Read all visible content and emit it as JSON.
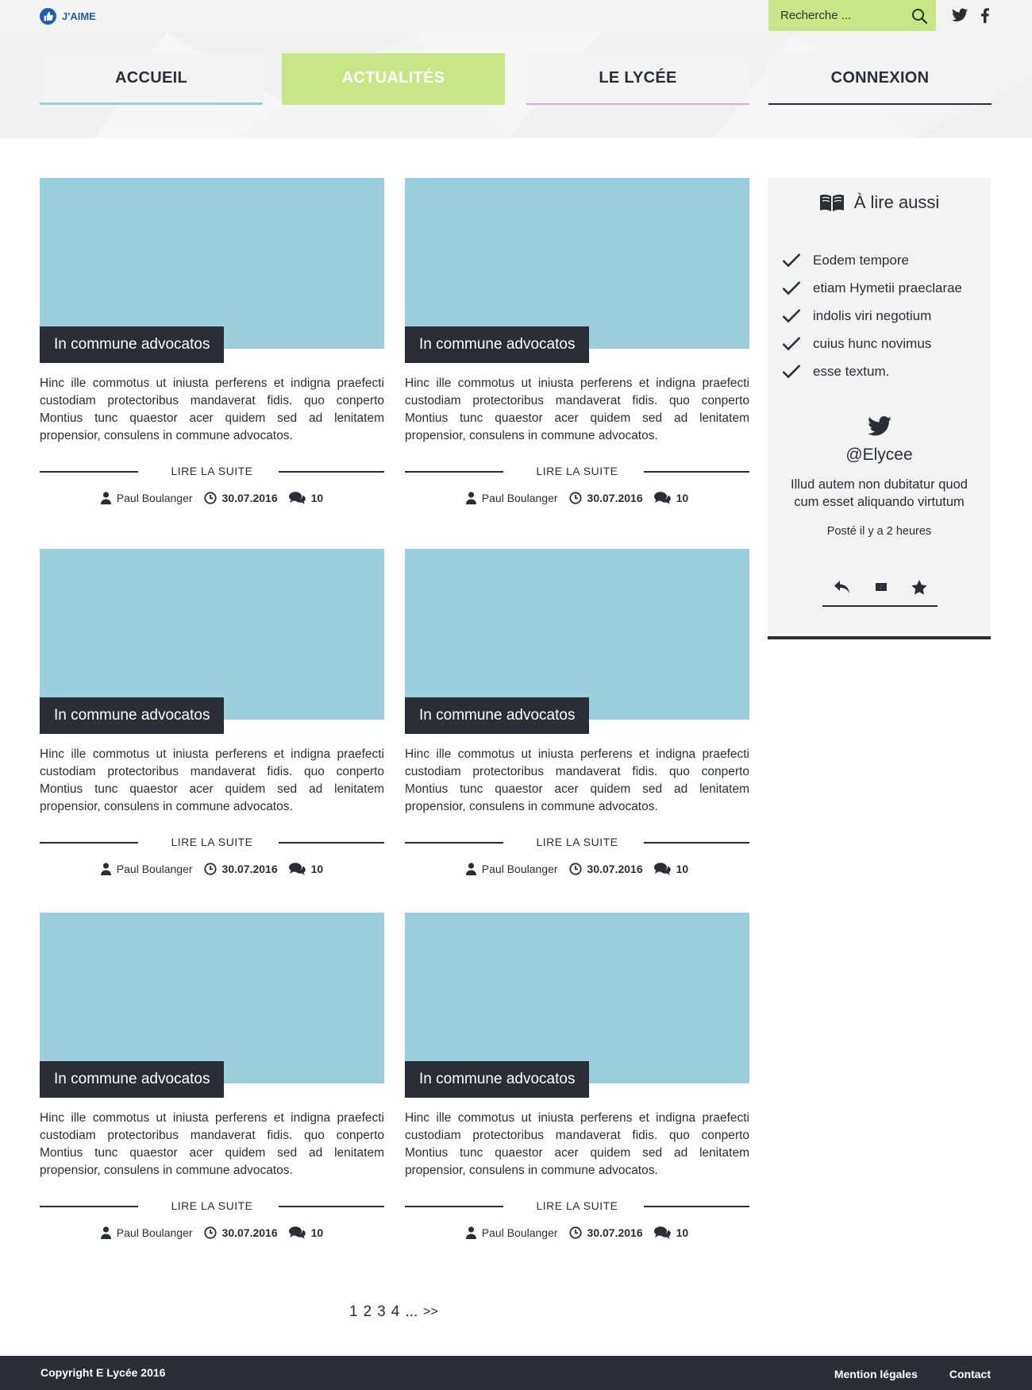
{
  "topbar": {
    "like_label": "J'AIME",
    "search_placeholder": "Recherche ...",
    "search_value": ""
  },
  "nav": {
    "items": [
      {
        "label": "ACCUEIL"
      },
      {
        "label": "ACTUALITÉS",
        "active": true
      },
      {
        "label": "LE LYCÉE"
      },
      {
        "label": "CONNEXION"
      }
    ]
  },
  "articles": [
    {
      "title": "In commune advocatos",
      "excerpt": "Hinc ille commotus ut iniusta perferens et indigna praefecti custodiam protectoribus mandaverat fidis. quo conperto Montius tunc quaestor acer quidem sed ad lenitatem propensior, consulens in commune advocatos.",
      "readmore": "LIRE LA SUITE",
      "author": "Paul Boulanger",
      "date": "30.07.2016",
      "comments": "10"
    },
    {
      "title": "In commune advocatos",
      "excerpt": "Hinc ille commotus ut iniusta perferens et indigna praefecti custodiam protectoribus mandaverat fidis. quo conperto Montius tunc quaestor acer quidem sed ad lenitatem propensior, consulens in commune advocatos.",
      "readmore": "LIRE LA SUITE",
      "author": "Paul Boulanger",
      "date": "30.07.2016",
      "comments": "10"
    },
    {
      "title": "In commune advocatos",
      "excerpt": "Hinc ille commotus ut iniusta perferens et indigna praefecti custodiam protectoribus mandaverat fidis. quo conperto Montius tunc quaestor acer quidem sed ad lenitatem propensior, consulens in commune advocatos.",
      "readmore": "LIRE LA SUITE",
      "author": "Paul Boulanger",
      "date": "30.07.2016",
      "comments": "10"
    },
    {
      "title": "In commune advocatos",
      "excerpt": "Hinc ille commotus ut iniusta perferens et indigna praefecti custodiam protectoribus mandaverat fidis. quo conperto Montius tunc quaestor acer quidem sed ad lenitatem propensior, consulens in commune advocatos.",
      "readmore": "LIRE LA SUITE",
      "author": "Paul Boulanger",
      "date": "30.07.2016",
      "comments": "10"
    },
    {
      "title": "In commune advocatos",
      "excerpt": "Hinc ille commotus ut iniusta perferens et indigna praefecti custodiam protectoribus mandaverat fidis. quo conperto Montius tunc quaestor acer quidem sed ad lenitatem propensior, consulens in commune advocatos.",
      "readmore": "LIRE LA SUITE",
      "author": "Paul Boulanger",
      "date": "30.07.2016",
      "comments": "10"
    },
    {
      "title": "In commune advocatos",
      "excerpt": "Hinc ille commotus ut iniusta perferens et indigna praefecti custodiam protectoribus mandaverat fidis. quo conperto Montius tunc quaestor acer quidem sed ad lenitatem propensior, consulens in commune advocatos.",
      "readmore": "LIRE LA SUITE",
      "author": "Paul Boulanger",
      "date": "30.07.2016",
      "comments": "10"
    }
  ],
  "sidebar": {
    "title": "À lire aussi",
    "links": [
      {
        "label": "Eodem tempore"
      },
      {
        "label": "etiam Hymetii praeclarae"
      },
      {
        "label": "indolis viri negotium"
      },
      {
        "label": "cuius hunc novimus"
      },
      {
        "label": "esse textum."
      }
    ],
    "twitter": {
      "handle": "@Elycee",
      "text": "Illud autem non dubitatur quod cum esset aliquando virtutum",
      "time": "Posté il y a 2 heures"
    }
  },
  "pagination": {
    "pages": [
      "1",
      "2",
      "3",
      "4"
    ],
    "ellipsis": "...",
    "next": ">>"
  },
  "footer": {
    "copyright": "Copyright E Lycée 2016",
    "links": [
      {
        "label": "Mention légales"
      },
      {
        "label": "Contact"
      }
    ]
  },
  "colors": {
    "accent_green": "#c7e787",
    "dark": "#2a2f36",
    "thumb_blue": "#9ccfdd",
    "like_blue": "#1f5fb0"
  }
}
